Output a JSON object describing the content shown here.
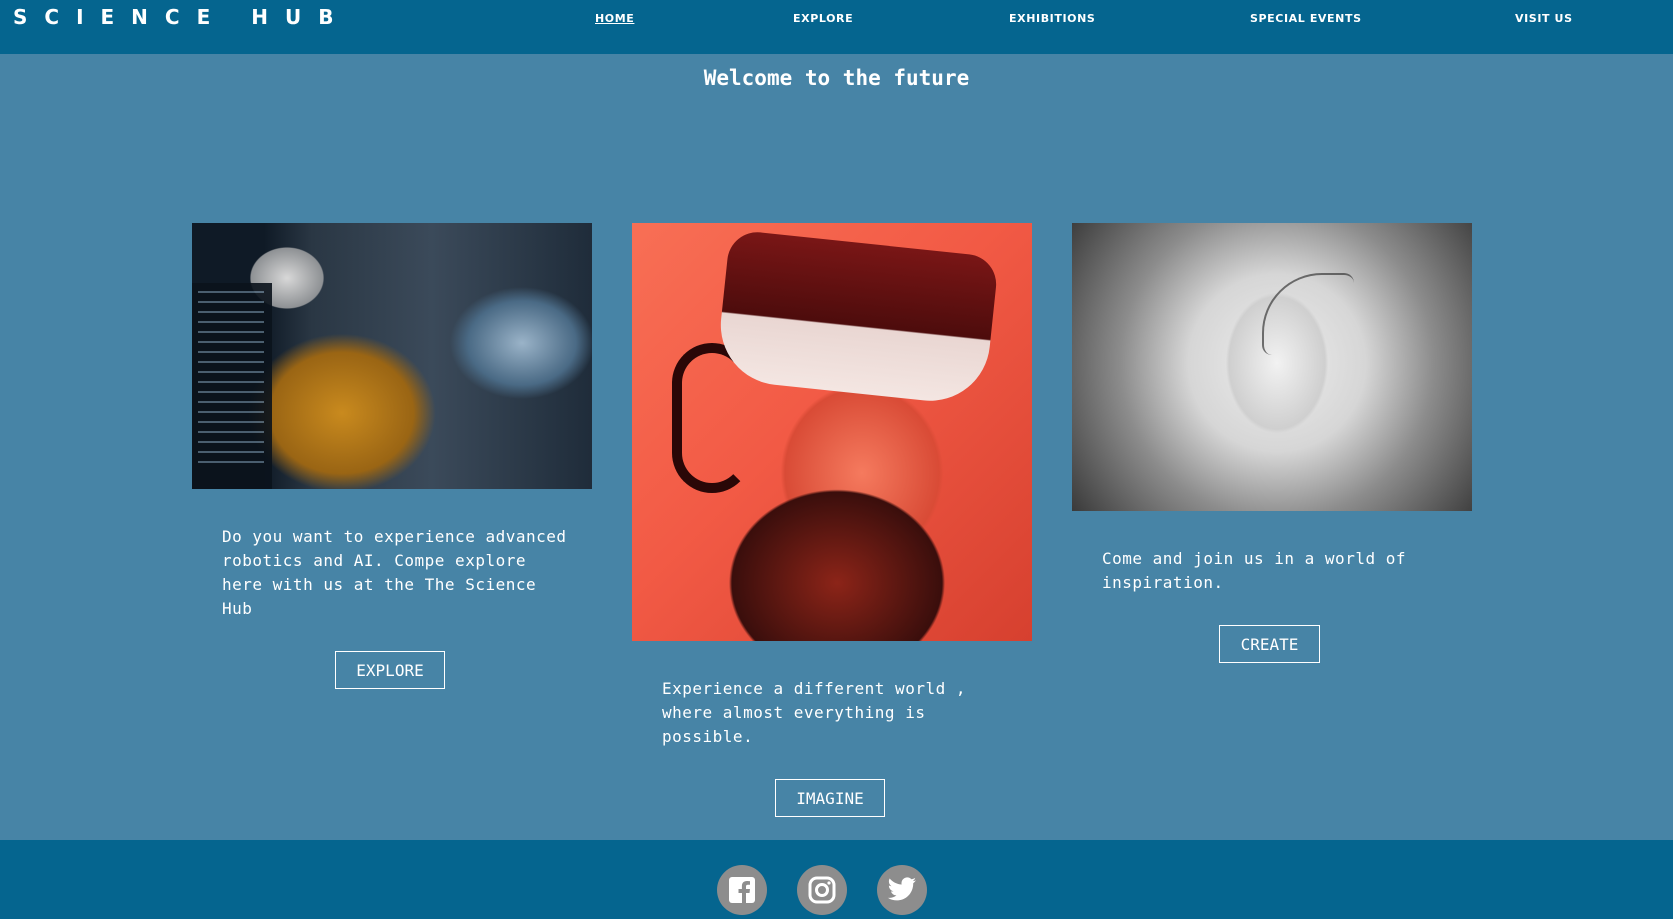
{
  "header": {
    "logo": "SCIENCE HUB",
    "nav": [
      {
        "label": "HOME",
        "active": true
      },
      {
        "label": "EXPLORE",
        "active": false
      },
      {
        "label": "EXHIBITIONS",
        "active": false
      },
      {
        "label": "SPECIAL EVENTS",
        "active": false
      },
      {
        "label": "VISIT US",
        "active": false
      }
    ]
  },
  "main": {
    "heading": "Welcome to the future",
    "cards": [
      {
        "text": "Do you want to experience advanced robotics and AI. Compe explore here with us at the The Science Hub",
        "button": "EXPLORE"
      },
      {
        "text": "Experience a different world , where almost everything is possible.",
        "button": "IMAGINE"
      },
      {
        "text": "Come and join us in a world of inspiration.",
        "button": "CREATE"
      }
    ]
  },
  "footer": {
    "social": [
      "facebook-icon",
      "instagram-icon",
      "twitter-icon"
    ]
  },
  "colors": {
    "header_bg": "#05658f",
    "page_bg": "#4784a6",
    "icon_bg": "#8d8d8d"
  }
}
